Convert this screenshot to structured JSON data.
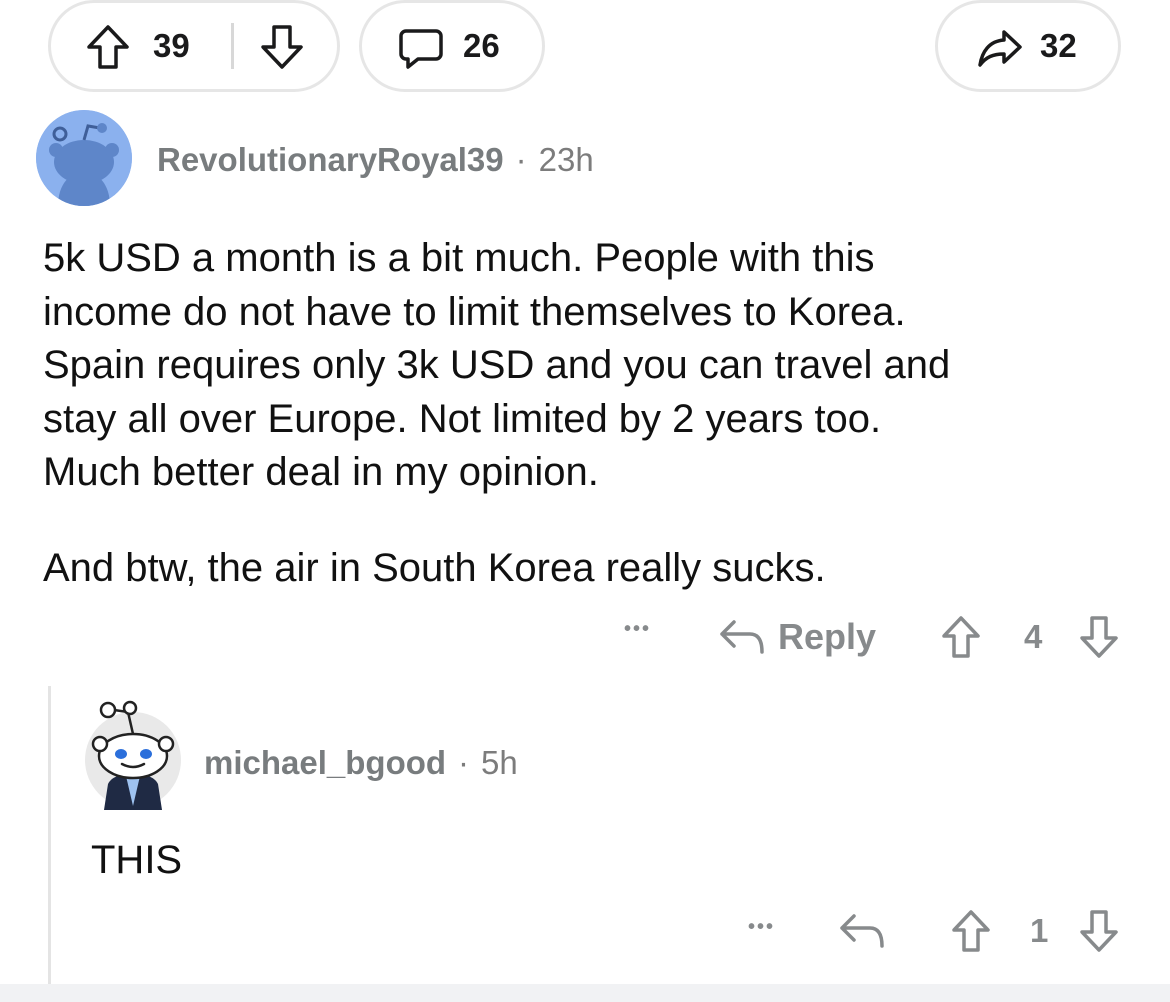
{
  "post_bar": {
    "upvotes": "39",
    "comments": "26",
    "shares": "32"
  },
  "comment1": {
    "username": "RevolutionaryRoyal39",
    "separator": "·",
    "time": "23h",
    "lines": [
      "5k USD a month is a bit much. People with this",
      "income do not have to limit themselves to Korea.",
      "Spain requires only 3k USD and you can travel and",
      "stay all over Europe. Not limited by 2 years too.",
      "Much better deal in my opinion."
    ],
    "paragraph2": "And btw, the air in South Korea really sucks.",
    "more": "•••",
    "reply_label": "Reply",
    "votes": "4"
  },
  "comment2": {
    "username": "michael_bgood",
    "separator": "·",
    "time": "5h",
    "text": "THIS",
    "more": "•••",
    "votes": "1"
  },
  "colors": {
    "icon_gray": "#878a8c",
    "avatar_blue": "#8bb1ee",
    "pill_border": "#e6e6e6"
  }
}
